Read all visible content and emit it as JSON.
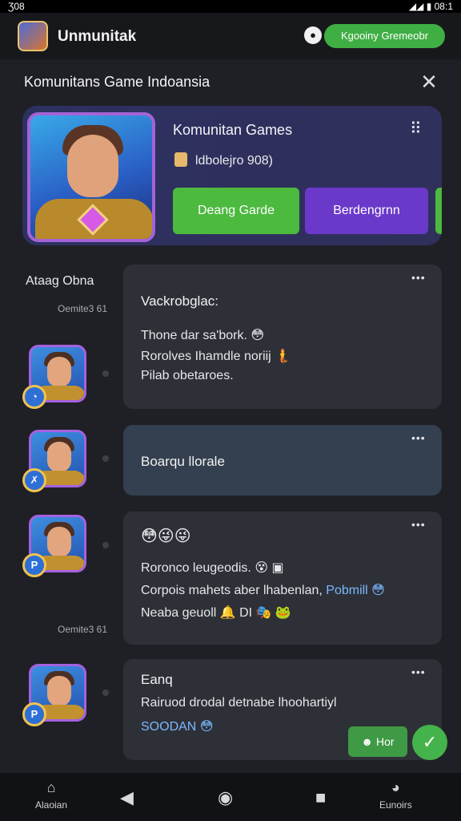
{
  "status_bar": {
    "time": "Ʒ08",
    "right_text": "◢◢ ▮ 08:1"
  },
  "app_bar": {
    "title": "Unmunitak",
    "join_label": "Kgooiny Gremeobr"
  },
  "sheet": {
    "title": "Komunitans Game Indoansia"
  },
  "hero": {
    "name": "Komunitan Games",
    "subtitle": "ldbolejro 908)",
    "primary_button": "Deang Garde",
    "secondary_button": "Berdengrnn"
  },
  "feed": {
    "section_label": "Ataag Obna",
    "timestamps": [
      "Oemite3 61",
      "Oemite3 61"
    ],
    "posts": [
      {
        "title": "Vackrobglac:",
        "lines": [
          "Thone dar sa'bork. 😳",
          "Rorolves Ihamdle noriij 🧜",
          "Pilab obetaroes."
        ],
        "badge": "◔"
      },
      {
        "title": "Boarqu llorale",
        "lines": [],
        "badge": "✗"
      },
      {
        "emojis": "😳😜😜",
        "lines": [
          "Roronco leugeodis. 😵 ▣",
          "Corpois mahets aber lhabenlan,",
          "Neaba geuoll 🔔 DI 🎭 🐸"
        ],
        "link": "Pobmill 😳",
        "badge": "P"
      },
      {
        "title": "Eanq",
        "lines": [
          "Rairuod drodal detnabe lhoohartiyl",
          "SOODAN 😳"
        ],
        "badge": "P"
      }
    ]
  },
  "actions": {
    "like_label": "Hor",
    "send_icon": "send-icon"
  },
  "bottom_nav": {
    "left_label": "Alaoian",
    "right_label": "Eunoirs"
  },
  "colors": {
    "accent_green": "#4cba3f",
    "accent_purple": "#6a39c9",
    "background": "#1f2026"
  }
}
